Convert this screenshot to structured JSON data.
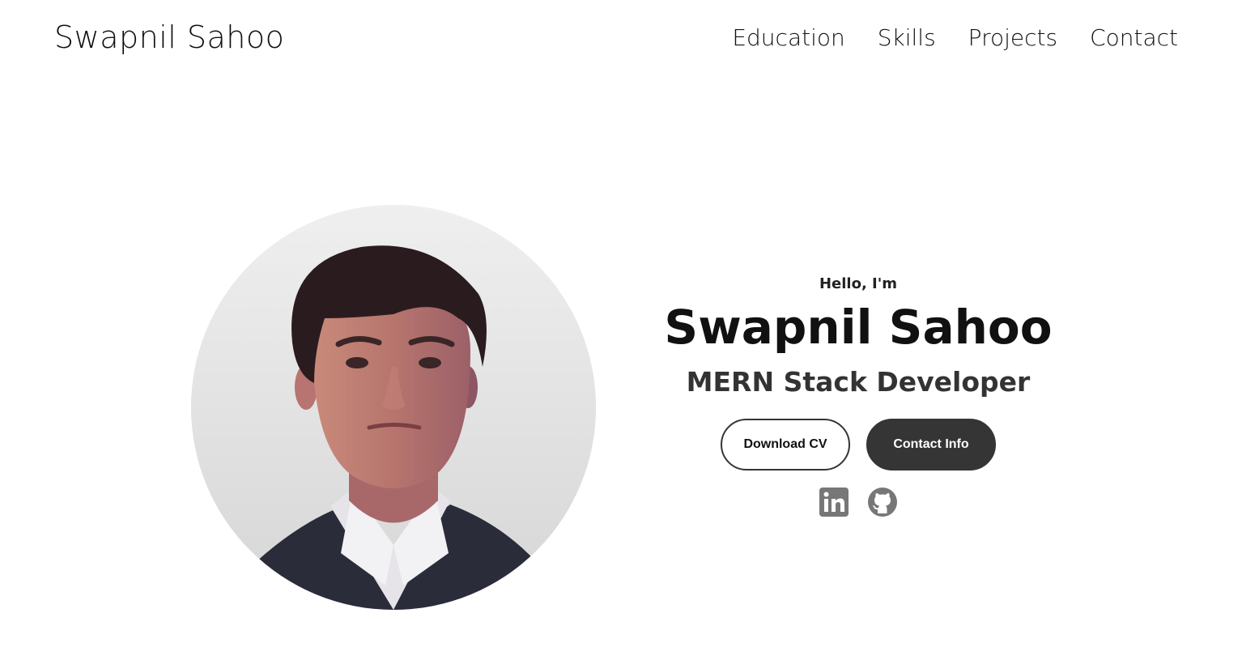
{
  "nav": {
    "logo": "Swapnil Sahoo",
    "links": [
      "Education",
      "Skills",
      "Projects",
      "Contact"
    ]
  },
  "hero": {
    "greeting": "Hello, I'm",
    "name": "Swapnil Sahoo",
    "role": "MERN Stack Developer",
    "buttons": {
      "download": "Download CV",
      "contact": "Contact Info"
    },
    "socials": [
      {
        "icon": "linkedin-icon"
      },
      {
        "icon": "github-icon"
      }
    ]
  },
  "colors": {
    "text": "#111111",
    "button_dark": "#353535",
    "icon": "#777777"
  }
}
